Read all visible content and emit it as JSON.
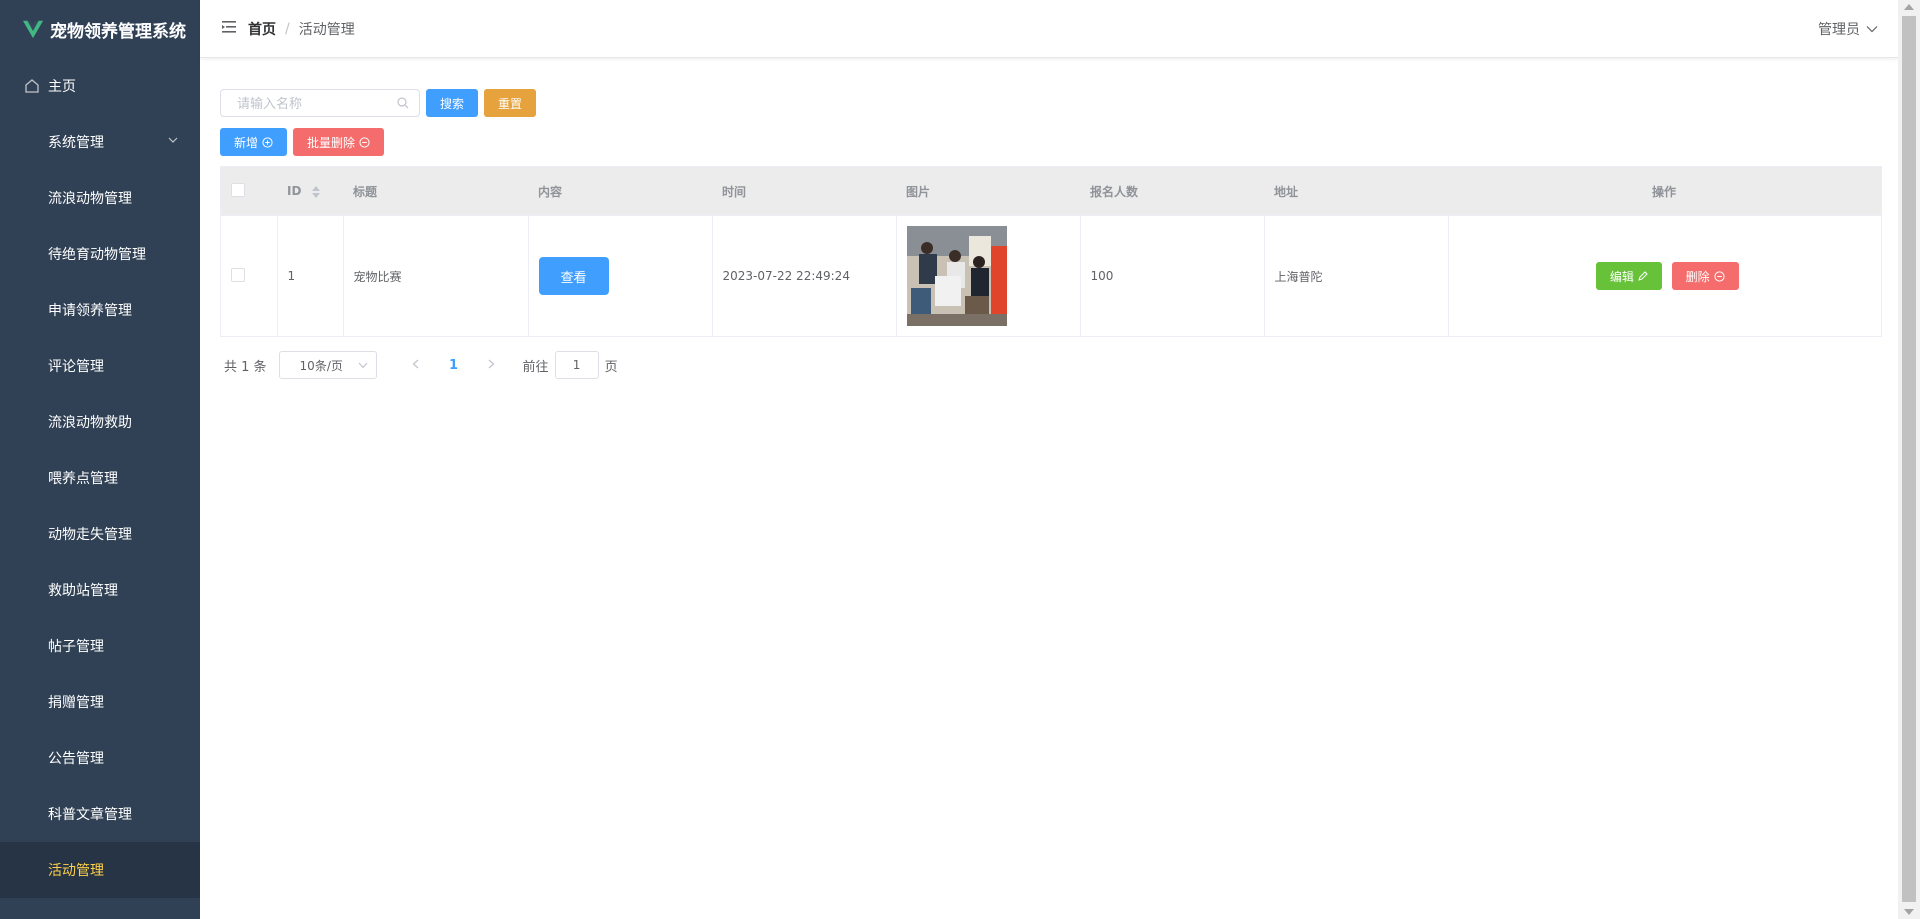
{
  "app": {
    "title": "宠物领养管理系统"
  },
  "sidebar": {
    "items": [
      {
        "label": "主页",
        "icon": "home-icon"
      },
      {
        "label": "系统管理",
        "icon": "grid-icon",
        "expandable": true
      },
      {
        "label": "流浪动物管理",
        "icon": "grid-icon"
      },
      {
        "label": "待绝育动物管理",
        "icon": "grid-icon"
      },
      {
        "label": "申请领养管理",
        "icon": "grid-icon"
      },
      {
        "label": "评论管理",
        "icon": "grid-icon"
      },
      {
        "label": "流浪动物救助",
        "icon": "grid-icon"
      },
      {
        "label": "喂养点管理",
        "icon": "grid-icon"
      },
      {
        "label": "动物走失管理",
        "icon": "grid-icon"
      },
      {
        "label": "救助站管理",
        "icon": "grid-icon"
      },
      {
        "label": "帖子管理",
        "icon": "grid-icon"
      },
      {
        "label": "捐赠管理",
        "icon": "grid-icon"
      },
      {
        "label": "公告管理",
        "icon": "grid-icon"
      },
      {
        "label": "科普文章管理",
        "icon": "grid-icon"
      },
      {
        "label": "活动管理",
        "icon": "grid-icon",
        "active": true
      }
    ],
    "colors": {
      "background": "#304156",
      "active_text": "#ffd04b"
    }
  },
  "header": {
    "breadcrumb": {
      "home": "首页",
      "separator": "/",
      "current": "活动管理"
    },
    "user": "管理员"
  },
  "toolbar": {
    "search_placeholder": "请输入名称",
    "search_label": "搜索",
    "reset_label": "重置",
    "add_label": "新增",
    "batch_delete_label": "批量删除"
  },
  "table": {
    "columns": [
      "ID",
      "标题",
      "内容",
      "时间",
      "图片",
      "报名人数",
      "地址",
      "操作"
    ],
    "rows": [
      {
        "id": "1",
        "title": "宠物比赛",
        "content_button": "查看",
        "time": "2023-07-22 22:49:24",
        "image": "pet-event-photo",
        "signups": "100",
        "address": "上海普陀",
        "edit_label": "编辑",
        "delete_label": "删除"
      }
    ]
  },
  "pagination": {
    "total": "共 1 条",
    "page_size": "10条/页",
    "current_page": "1",
    "goto_prefix": "前往",
    "goto_value": "1",
    "goto_suffix": "页"
  },
  "colors": {
    "primary": "#409eff",
    "warning": "#e6a23c",
    "danger": "#f56c6c",
    "success": "#67c23a"
  }
}
